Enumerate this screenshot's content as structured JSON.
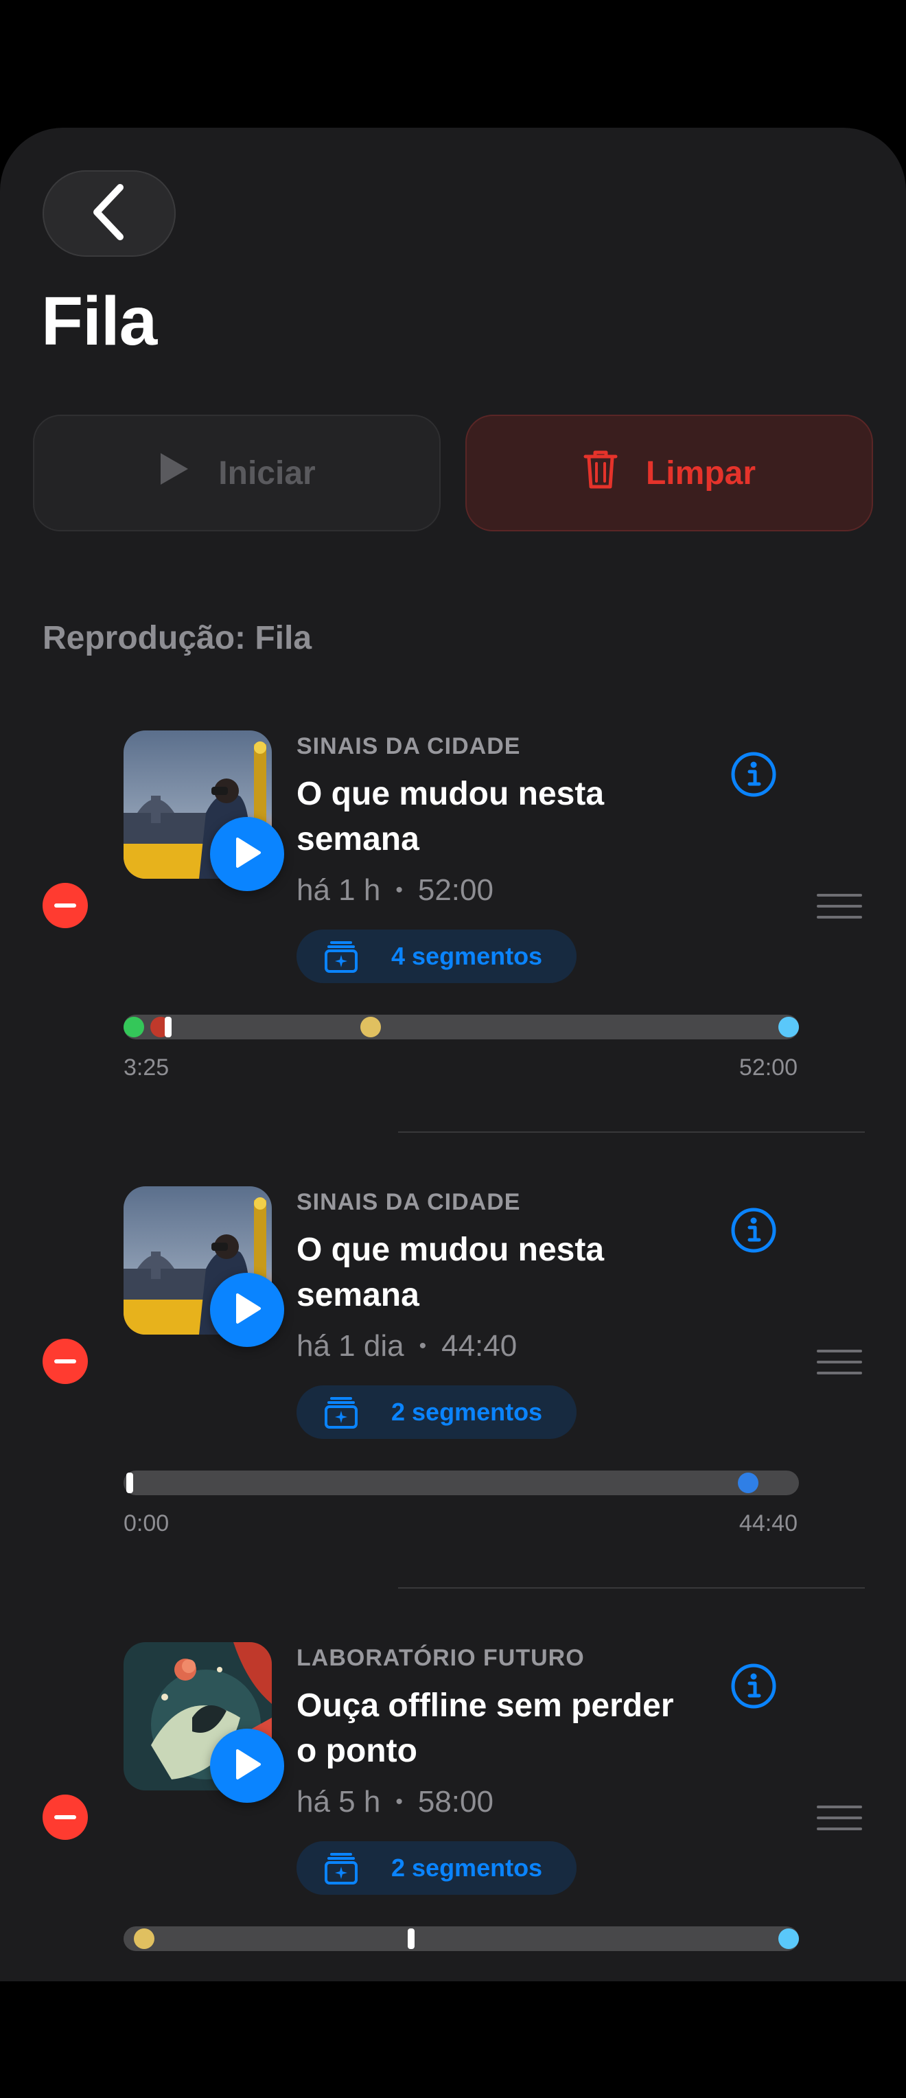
{
  "colors": {
    "accent": "#0a84ff",
    "destructive": "#ff3b30",
    "background": "#1c1c1e",
    "secondary_text": "#8e8e93"
  },
  "header": {
    "back_icon": "chevron-left-icon",
    "title": "Fila"
  },
  "actions": {
    "start_label": "Iniciar",
    "start_icon": "play-icon",
    "clear_label": "Limpar",
    "clear_icon": "trash-icon"
  },
  "section": {
    "label": "Reprodução: Fila"
  },
  "queue": [
    {
      "podcast": "SINAIS DA CIDADE",
      "title": "O que mudou nesta semana",
      "age": "há 1 h",
      "duration": "52:00",
      "segments_label": "4 segmentos",
      "time_start": "3:25",
      "time_end": "52:00",
      "artwork": "city-skyline-artwork",
      "markers": [
        {
          "kind": "dot",
          "position": 0.0,
          "color": "#34c759"
        },
        {
          "kind": "dot",
          "position": 0.055,
          "color": "#c0392b"
        },
        {
          "kind": "tick",
          "position": 0.066,
          "color": "#ffffff"
        },
        {
          "kind": "dot",
          "position": 0.366,
          "color": "#e0c060"
        },
        {
          "kind": "dot",
          "position": 1.0,
          "color": "#5ac8fa"
        }
      ]
    },
    {
      "podcast": "SINAIS DA CIDADE",
      "title": "O que mudou nesta semana",
      "age": "há 1 dia",
      "duration": "44:40",
      "segments_label": "2 segmentos",
      "time_start": "0:00",
      "time_end": "44:40",
      "artwork": "city-skyline-artwork",
      "markers": [
        {
          "kind": "tick",
          "position": 0.0,
          "color": "#ffffff"
        },
        {
          "kind": "dot",
          "position": 0.925,
          "color": "#2f7fe6"
        }
      ]
    },
    {
      "podcast": "LABORATÓRIO FUTURO",
      "title": "Ouça offline sem perder o ponto",
      "age": "há 5 h",
      "duration": "58:00",
      "segments_label": "2 segmentos",
      "time_start": "",
      "time_end": "",
      "artwork": "abstract-collage-artwork",
      "markers": [
        {
          "kind": "dot",
          "position": 0.03,
          "color": "#e0c060"
        },
        {
          "kind": "tick",
          "position": 0.426,
          "color": "#ffffff"
        },
        {
          "kind": "dot",
          "position": 1.0,
          "color": "#5ac8fa"
        }
      ]
    }
  ]
}
